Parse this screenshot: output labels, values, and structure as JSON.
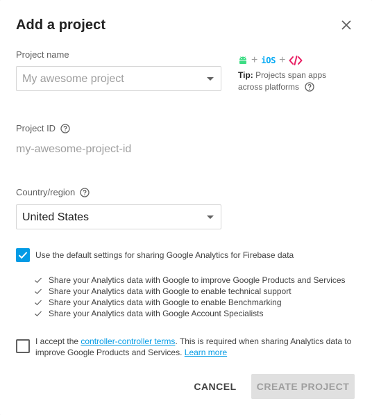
{
  "dialog": {
    "title": "Add a project"
  },
  "project_name": {
    "label": "Project name",
    "value": "My awesome project"
  },
  "tip": {
    "plus": "+",
    "ios_label": "iOS",
    "bold": "Tip:",
    "text": " Projects span apps across platforms"
  },
  "project_id": {
    "label": "Project ID",
    "value": "my-awesome-project-id"
  },
  "country": {
    "label": "Country/region",
    "value": "United States"
  },
  "analytics": {
    "default_settings_label": "Use the default settings for sharing Google Analytics for Firebase data",
    "default_checked": true,
    "items": [
      "Share your Analytics data with Google to improve Google Products and Services",
      "Share your Analytics data with Google to enable technical support",
      "Share your Analytics data with Google to enable Benchmarking",
      "Share your Analytics data with Google Account Specialists"
    ]
  },
  "terms": {
    "checked": false,
    "prefix": "I accept the ",
    "link": "controller-controller terms",
    "middle": ". This is required when sharing Analytics data to improve Google Products and Services. ",
    "learn_more": "Learn more"
  },
  "actions": {
    "cancel": "CANCEL",
    "create": "CREATE PROJECT"
  },
  "colors": {
    "accent": "#039be5",
    "android": "#3ddc84",
    "ios": "#03a9f4",
    "web": "#e91e63"
  }
}
